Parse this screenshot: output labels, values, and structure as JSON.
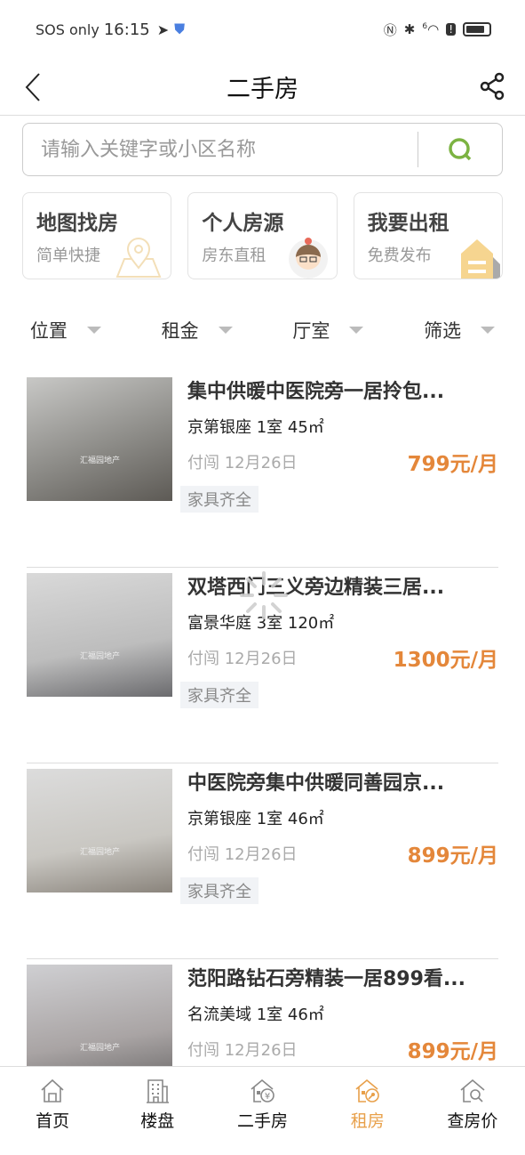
{
  "status": {
    "carrier": "SOS only",
    "time": "16:15",
    "wifi_label": "6"
  },
  "header": {
    "title": "二手房"
  },
  "search": {
    "placeholder": "请输入关键字或小区名称"
  },
  "cards": [
    {
      "title": "地图找房",
      "subtitle": "简单快捷",
      "icon": "map-pin-icon"
    },
    {
      "title": "个人房源",
      "subtitle": "房东直租",
      "icon": "avatar-icon"
    },
    {
      "title": "我要出租",
      "subtitle": "免费发布",
      "icon": "house-icon"
    }
  ],
  "filters": [
    "位置",
    "租金",
    "厅室",
    "筛选"
  ],
  "listings": [
    {
      "title": "集中供暖中医院旁一居拎包...",
      "meta": "京第银座 1室 45㎡",
      "date": "付闯  12月26日",
      "price": "799元/月",
      "tag": "家具齐全",
      "watermark": "汇福园地产"
    },
    {
      "title": "双塔西门三义旁边精装三居...",
      "meta": "富景华庭 3室 120㎡",
      "date": "付闯  12月26日",
      "price": "1300元/月",
      "tag": "家具齐全",
      "watermark": "汇福园地产"
    },
    {
      "title": "中医院旁集中供暖同善园京...",
      "meta": "京第银座 1室 46㎡",
      "date": "付闯  12月26日",
      "price": "899元/月",
      "tag": "家具齐全",
      "watermark": "汇福园地产"
    },
    {
      "title": "范阳路钻石旁精装一居899看...",
      "meta": "名流美域 1室 46㎡",
      "date": "付闯  12月26日",
      "price": "899元/月",
      "tag": "",
      "watermark": "汇福园地产"
    }
  ],
  "tabbar": [
    {
      "label": "首页",
      "icon": "home-icon",
      "active": false
    },
    {
      "label": "楼盘",
      "icon": "building-icon",
      "active": false
    },
    {
      "label": "二手房",
      "icon": "house-yuan-icon",
      "active": false
    },
    {
      "label": "租房",
      "icon": "house-key-icon",
      "active": true
    },
    {
      "label": "查房价",
      "icon": "house-search-icon",
      "active": false
    }
  ],
  "colors": {
    "accent": "#e4873a",
    "search_icon": "#7cb342",
    "active_tab": "#e8a04a"
  }
}
